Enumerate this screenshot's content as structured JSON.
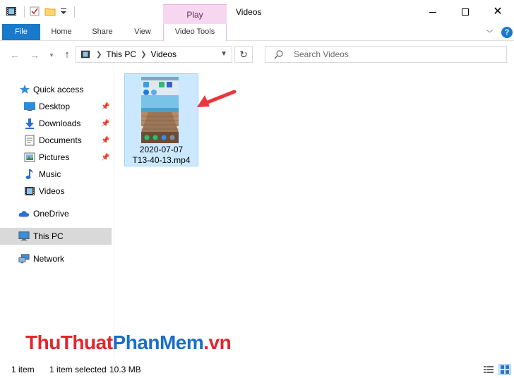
{
  "window": {
    "title": "Videos",
    "context_tab_group": "Play"
  },
  "ribbon": {
    "tabs": [
      "File",
      "Home",
      "Share",
      "View",
      "Video Tools"
    ]
  },
  "address_bar": {
    "path": [
      "This PC",
      "Videos"
    ],
    "search_placeholder": "Search Videos"
  },
  "nav_pane": {
    "quick_access": "Quick access",
    "pinned": [
      {
        "label": "Desktop",
        "icon": "desktop-icon"
      },
      {
        "label": "Downloads",
        "icon": "downloads-icon"
      },
      {
        "label": "Documents",
        "icon": "documents-icon"
      },
      {
        "label": "Pictures",
        "icon": "pictures-icon"
      }
    ],
    "unpinned": [
      {
        "label": "Music",
        "icon": "music-icon"
      },
      {
        "label": "Videos",
        "icon": "videos-icon"
      }
    ],
    "onedrive": "OneDrive",
    "this_pc": "This PC",
    "network": "Network"
  },
  "files": [
    {
      "name_line1": "2020-07-07",
      "name_line2": "T13-40-13.mp4",
      "selected": true
    }
  ],
  "watermark": {
    "part1": "ThuThuat",
    "part2": "PhanMem",
    "part3": ".vn"
  },
  "status": {
    "count": "1 item",
    "selected": "1 item selected",
    "size": "10.3 MB"
  },
  "colors": {
    "accent": "#1979ca",
    "selection": "#cce8ff",
    "context_tab": "#f7d6f0",
    "arrow": "#e8383d"
  }
}
